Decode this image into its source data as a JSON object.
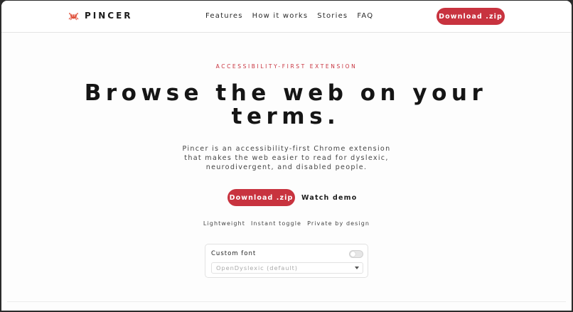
{
  "nav": {
    "brand_icon": "crab-icon",
    "brand_name": "PINCER",
    "links": [
      "Features",
      "How it works",
      "Stories",
      "FAQ"
    ],
    "cta_label": "Download .zip"
  },
  "hero": {
    "eyebrow": "ACCESSIBILITY-FIRST EXTENSION",
    "headline": "Browse the web on your terms.",
    "lede": "Pincer is an accessibility-first Chrome extension that makes the web easier to read for dyslexic, neurodivergent, and disabled people.",
    "primary_cta": "Download .zip",
    "secondary_cta": "Watch demo",
    "features": [
      "Lightweight",
      "Instant toggle",
      "Private by design"
    ]
  },
  "settings_card": {
    "label": "Custom font",
    "toggle_on": false,
    "select_value": "OpenDyslexic (default)"
  },
  "colors": {
    "accent": "#c8333f",
    "background": "#fdfdfd",
    "text": "#1c1c1c"
  }
}
